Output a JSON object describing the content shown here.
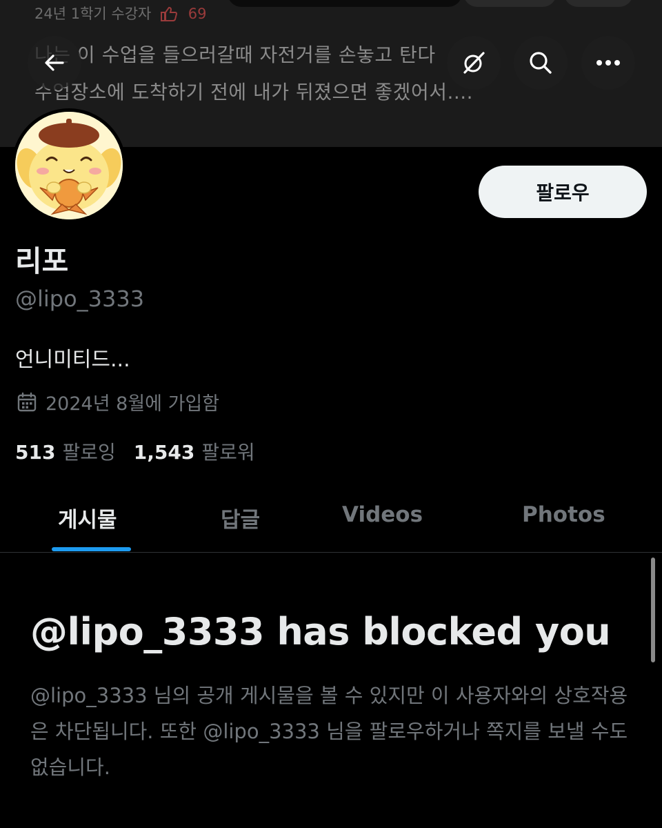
{
  "banner": {
    "meta_text": "24년 1학기 수강자",
    "likes": "69",
    "line1": "나는 이 수업을 들으러갈때 자전거를 손놓고 탄다",
    "line2": "수업장소에 도착하기 전에 내가 뒤졌으면 좋겠어서...."
  },
  "nav": {
    "back_icon": "arrow-left-icon",
    "grok_icon": "grok-icon",
    "search_icon": "search-icon",
    "more_icon": "more-dots-icon"
  },
  "profile": {
    "avatar_icon": "pompompurin-avatar",
    "display_name": "리포",
    "handle": "@lipo_3333",
    "bio": "언니미티드...",
    "joined": "2024년 8월에 가입함",
    "following_count": "513",
    "following_label": "팔로잉",
    "followers_count": "1,543",
    "followers_label": "팔로워",
    "follow_label": "팔로우"
  },
  "tabs": [
    {
      "label": "게시물",
      "active": true
    },
    {
      "label": "답글",
      "active": false
    },
    {
      "label": "Videos",
      "active": false
    },
    {
      "label": "Photos",
      "active": false
    }
  ],
  "blocked": {
    "title": "@lipo_3333 has blocked you",
    "body": "@lipo_3333 님의 공개 게시물을 볼 수 있지만 이 사용자와의 상호작용은 차단됩니다. 또한 @lipo_3333 님을 팔로우하거나 쪽지를 보낼 수도 없습니다."
  },
  "colors": {
    "accent": "#1d9bf0",
    "muted": "#71767b",
    "text": "#e7e9ea",
    "background": "#000000",
    "follow_button": "#eff3f4"
  }
}
